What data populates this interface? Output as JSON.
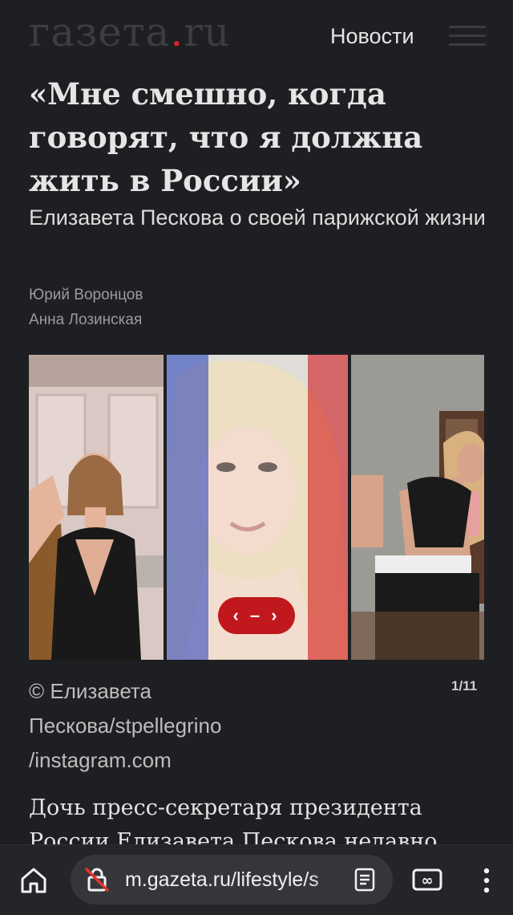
{
  "header": {
    "logo_main": "газета",
    "logo_dot": ".",
    "logo_tld": "ru",
    "nav_label": "Новости"
  },
  "article": {
    "headline": "«Мне смешно, когда говорят, что я должна жить в России»",
    "subtitle": "Елизавета Пескова о своей парижской жизни",
    "authors": [
      "Юрий Воронцов",
      "Анна Лозинская"
    ],
    "gallery": {
      "slider_label": "‹ – ›",
      "caption": "© Елизавета Пескова/stpellegrino /instagram.com",
      "counter": "1/11"
    },
    "body_start": "Дочь пресс-секретаря президента России Елизавета Пескова недавно"
  },
  "browser": {
    "url": "m.gazeta.ru/lifestyle/s",
    "icons": [
      "home-icon",
      "lock-off-icon",
      "reader-mode-icon",
      "tab-switcher-icon",
      "more-vert-icon"
    ]
  },
  "colors": {
    "background": "#1e1f22",
    "accent": "#c0181d",
    "logo": "#3c3d40"
  }
}
